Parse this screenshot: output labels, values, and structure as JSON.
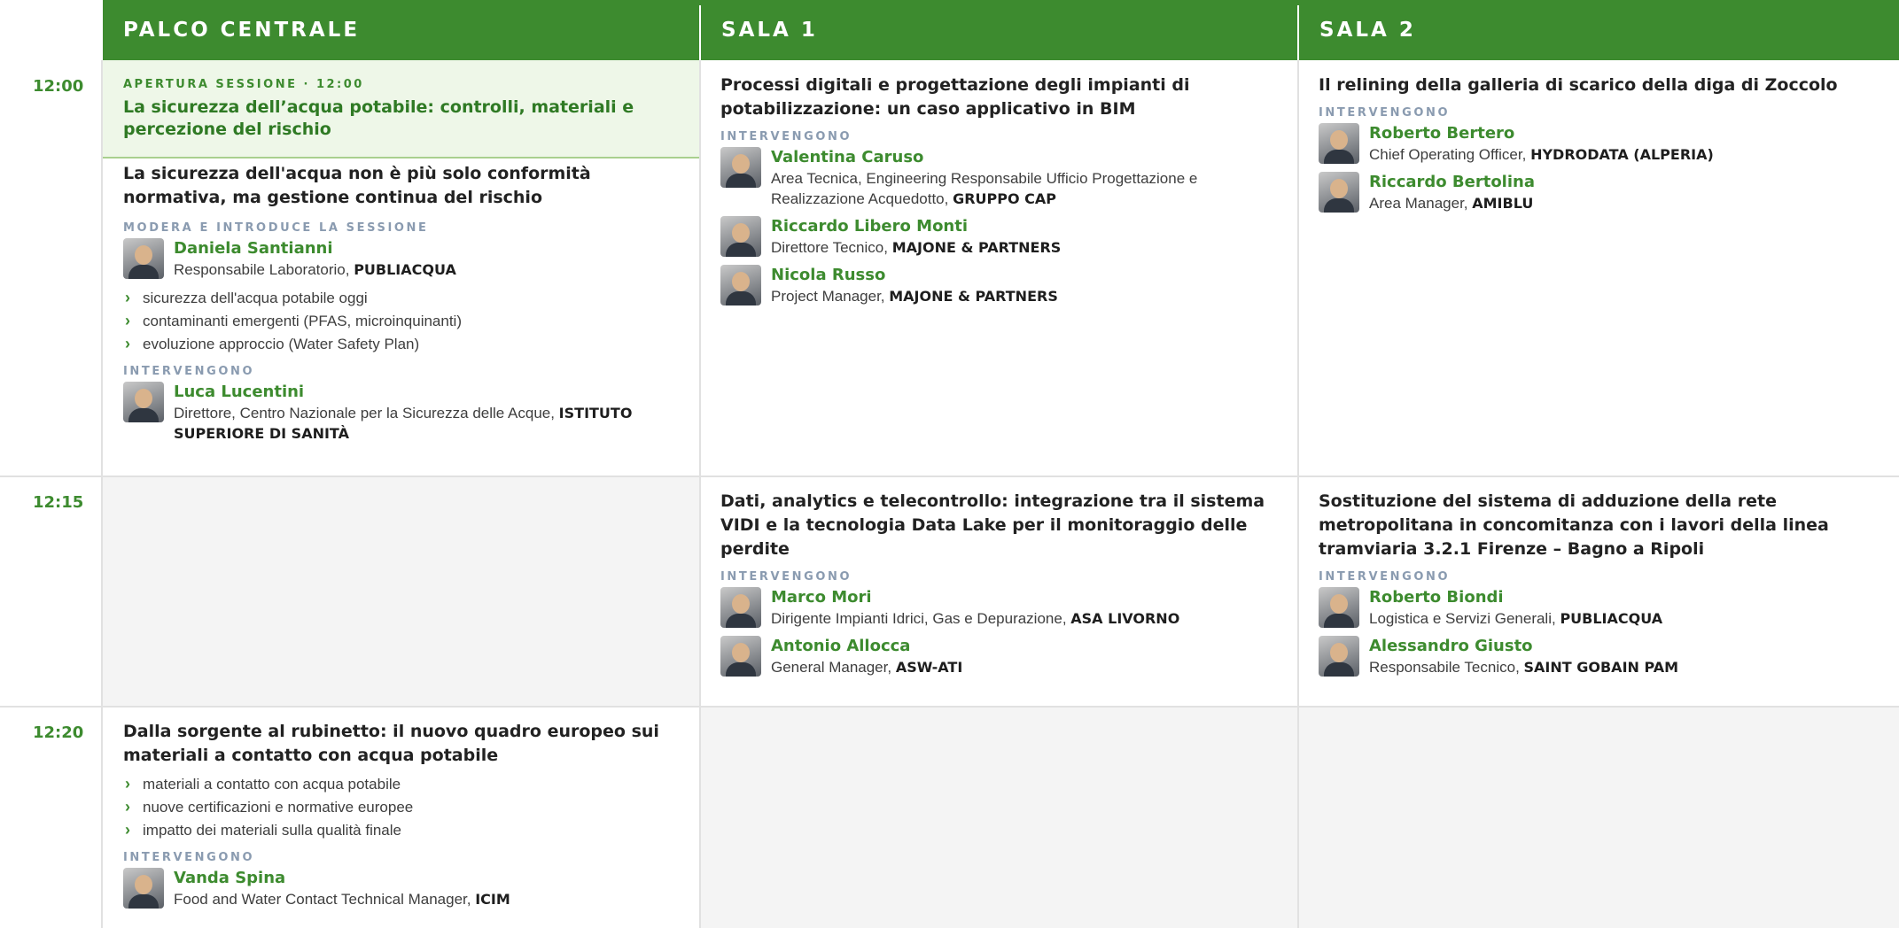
{
  "columns": [
    "PALCO CENTRALE",
    "SALA 1",
    "SALA 2"
  ],
  "times": [
    "12:00",
    "12:15",
    "12:20"
  ],
  "labels": {
    "modera": "MODERA E INTRODUCE LA SESSIONE",
    "intervengono": "INTERVENGONO"
  },
  "opening": {
    "kicker": "APERTURA SESSIONE · 12:00",
    "title": "La sicurezza dell’acqua potabile: controlli, materiali e percezione del rischio"
  },
  "palco_1200": {
    "title": "La sicurezza dell'acqua non è più solo conformità normativa, ma gestione continua del rischio",
    "moderator": {
      "name": "Daniela Santianni",
      "role": "Responsabile Laboratorio, ",
      "org": "PUBLIACQUA"
    },
    "topics": [
      "sicurezza dell'acqua potabile oggi",
      "contaminanti emergenti (PFAS, microinquinanti)",
      "evoluzione approccio (Water Safety Plan)"
    ],
    "speakers": [
      {
        "name": "Luca Lucentini",
        "role": "Direttore, Centro Nazionale per la Sicurezza delle Acque, ",
        "org": "ISTITUTO SUPERIORE DI SANITÀ"
      }
    ]
  },
  "sala1_1200": {
    "title": "Processi digitali e progettazione degli impianti di potabilizzazione: un caso applicativo in BIM",
    "speakers": [
      {
        "name": "Valentina Caruso",
        "role": "Area Tecnica, Engineering Responsabile Ufficio Progettazione e Realizzazione Acquedotto, ",
        "org": "GRUPPO CAP"
      },
      {
        "name": "Riccardo Libero Monti",
        "role": "Direttore Tecnico, ",
        "org": "MAJONE & PARTNERS"
      },
      {
        "name": "Nicola Russo",
        "role": "Project Manager, ",
        "org": "MAJONE & PARTNERS"
      }
    ]
  },
  "sala2_1200": {
    "title": "Il relining della galleria di scarico della diga di Zoccolo",
    "speakers": [
      {
        "name": "Roberto Bertero",
        "role": "Chief Operating Officer, ",
        "org": "HYDRODATA (ALPERIA)"
      },
      {
        "name": "Riccardo Bertolina",
        "role": "Area Manager, ",
        "org": "AMIBLU"
      }
    ]
  },
  "sala1_1215": {
    "title": "Dati, analytics e telecontrollo: integrazione tra il sistema VIDI e la tecnologia Data Lake per il monitoraggio delle perdite",
    "speakers": [
      {
        "name": "Marco Mori",
        "role": "Dirigente Impianti Idrici, Gas e Depurazione, ",
        "org": "ASA LIVORNO"
      },
      {
        "name": "Antonio Allocca",
        "role": "General Manager, ",
        "org": "ASW-ATI"
      }
    ]
  },
  "sala2_1215": {
    "title": "Sostituzione del sistema di adduzione della rete metropolitana in concomitanza con i lavori della linea tramviaria 3.2.1 Firenze – Bagno a Ripoli",
    "speakers": [
      {
        "name": "Roberto Biondi",
        "role": "Logistica e Servizi Generali, ",
        "org": "PUBLIACQUA"
      },
      {
        "name": "Alessandro Giusto",
        "role": "Responsabile Tecnico, ",
        "org": "SAINT GOBAIN PAM"
      }
    ]
  },
  "palco_1220": {
    "title": "Dalla sorgente al rubinetto: il nuovo quadro europeo sui materiali a contatto con acqua potabile",
    "topics": [
      "materiali a contatto con acqua potabile",
      "nuove certificazioni e normative europee",
      "impatto dei materiali sulla qualità finale"
    ],
    "speakers": [
      {
        "name": "Vanda Spina",
        "role": "Food and Water Contact Technical Manager, ",
        "org": "ICIM"
      }
    ]
  },
  "colors": {
    "brand_green": "#3d8b2f",
    "opening_bg": "#eef7e8",
    "empty_bg": "#f4f4f4"
  }
}
